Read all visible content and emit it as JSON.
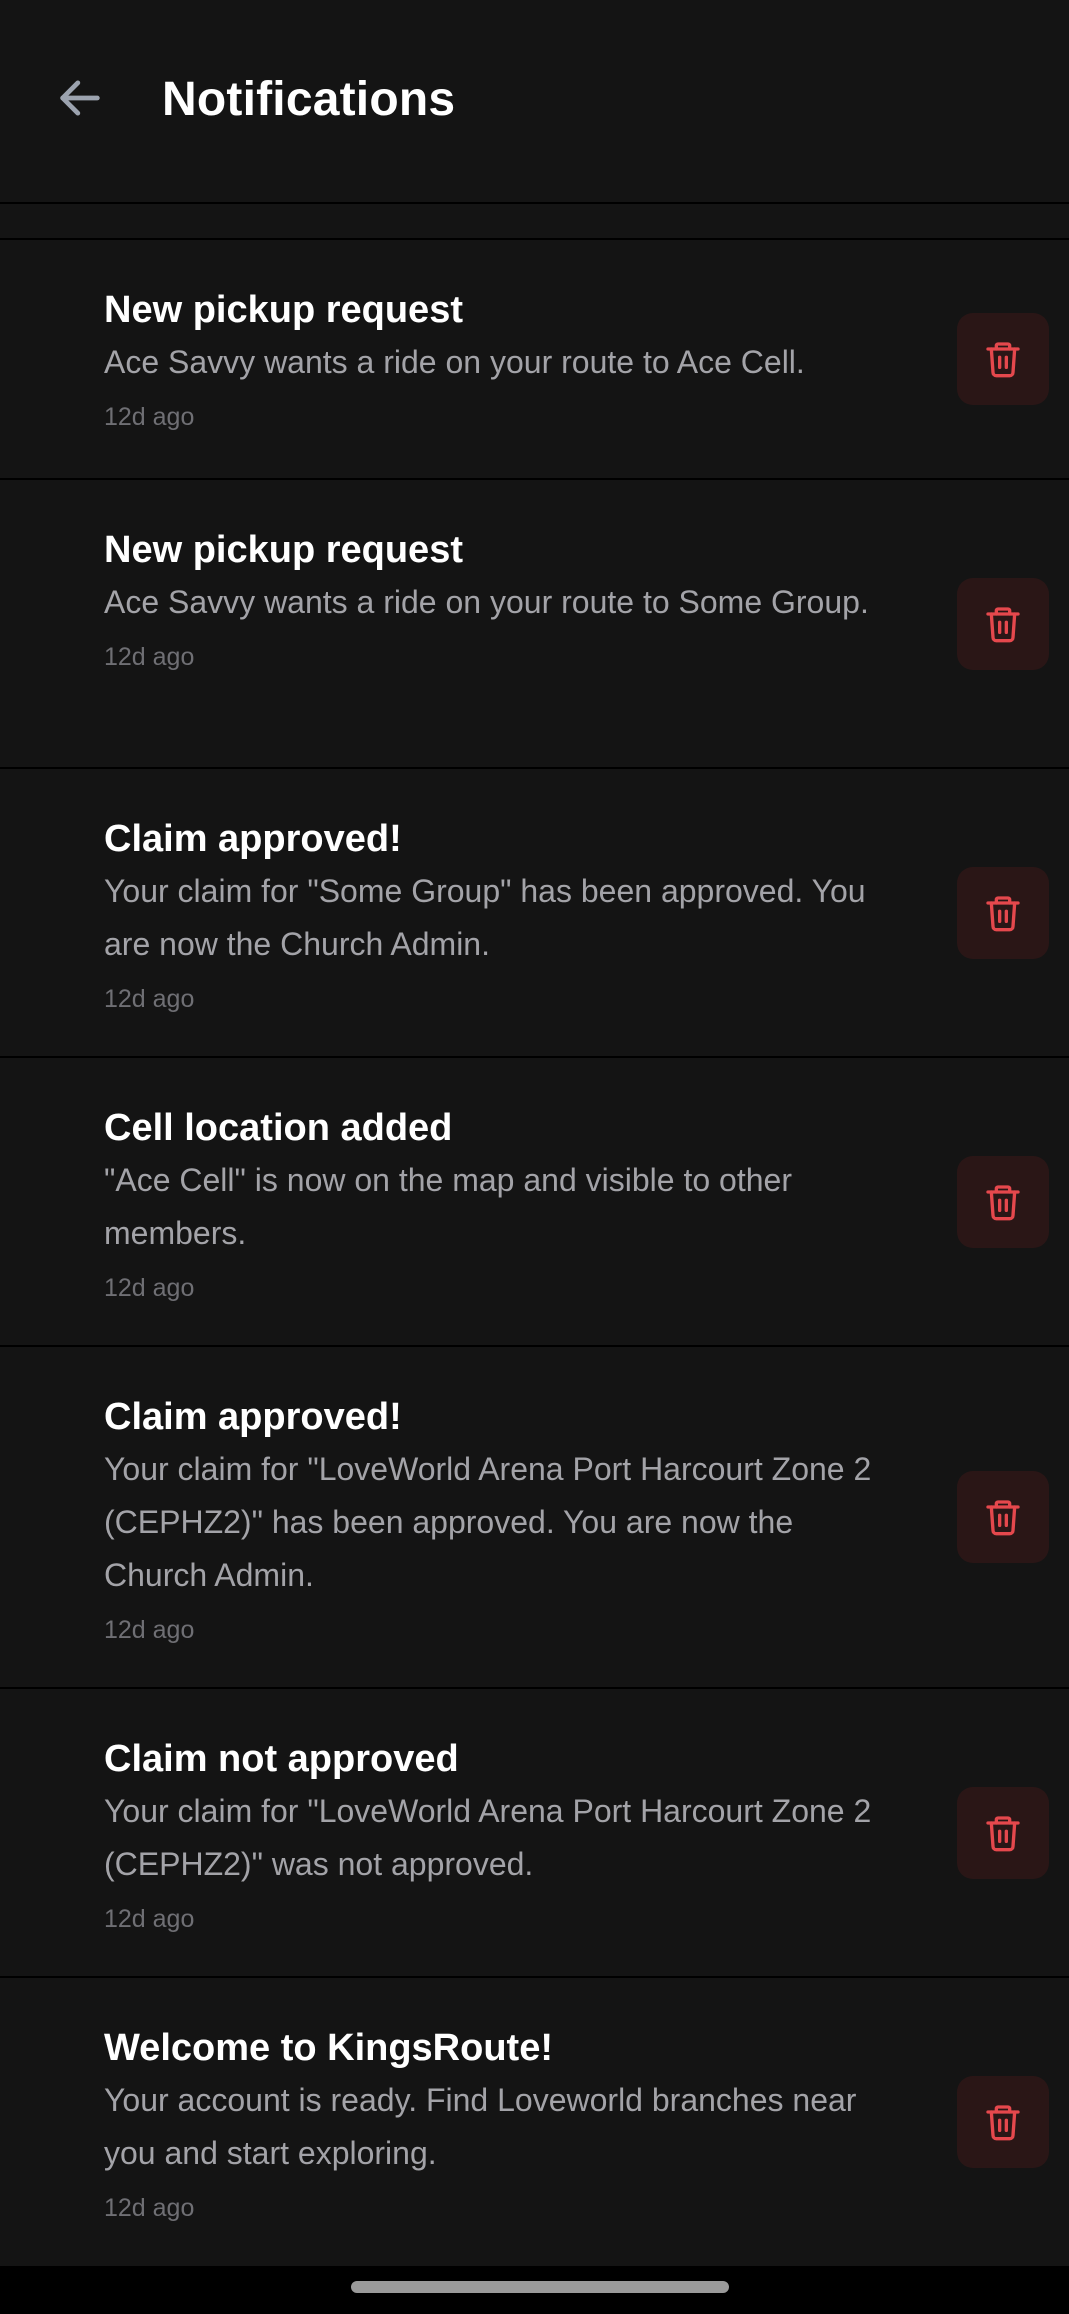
{
  "header": {
    "title": "Notifications",
    "back_icon": "arrow-left-icon"
  },
  "colors": {
    "background": "#141414",
    "divider": "#000000",
    "title_text": "#ffffff",
    "body_text": "#a3a3a8",
    "time_text": "#6f6f74",
    "delete_icon": "#e5484d",
    "delete_bg": "#2a1616"
  },
  "notifications": [
    {
      "title": "New pickup request",
      "body": "Ace Savvy wants a ride on your route to Ace Cell.",
      "time": "12d ago",
      "delete_icon": "trash-icon"
    },
    {
      "title": "New pickup request",
      "body": "Ace Savvy wants a ride on your route to Some Group.",
      "time": "12d ago",
      "delete_icon": "trash-icon"
    },
    {
      "title": "Claim approved!",
      "body": "Your claim for \"Some Group\" has been approved. You are now the Church Admin.",
      "time": "12d ago",
      "delete_icon": "trash-icon"
    },
    {
      "title": "Cell location added",
      "body": "\"Ace Cell\" is now on the map and visible to other members.",
      "time": "12d ago",
      "delete_icon": "trash-icon"
    },
    {
      "title": "Claim approved!",
      "body": "Your claim for \"LoveWorld Arena Port Harcourt Zone 2 (CEPHZ2)\" has been approved. You are now the Church Admin.",
      "time": "12d ago",
      "delete_icon": "trash-icon"
    },
    {
      "title": "Claim not approved",
      "body": "Your claim for \"LoveWorld Arena Port Harcourt Zone 2 (CEPHZ2)\" was not approved.",
      "time": "12d ago",
      "delete_icon": "trash-icon"
    },
    {
      "title": "Welcome to KingsRoute!",
      "body": "Your account is ready. Find Loveworld branches near you and start exploring.",
      "time": "12d ago",
      "delete_icon": "trash-icon"
    }
  ]
}
